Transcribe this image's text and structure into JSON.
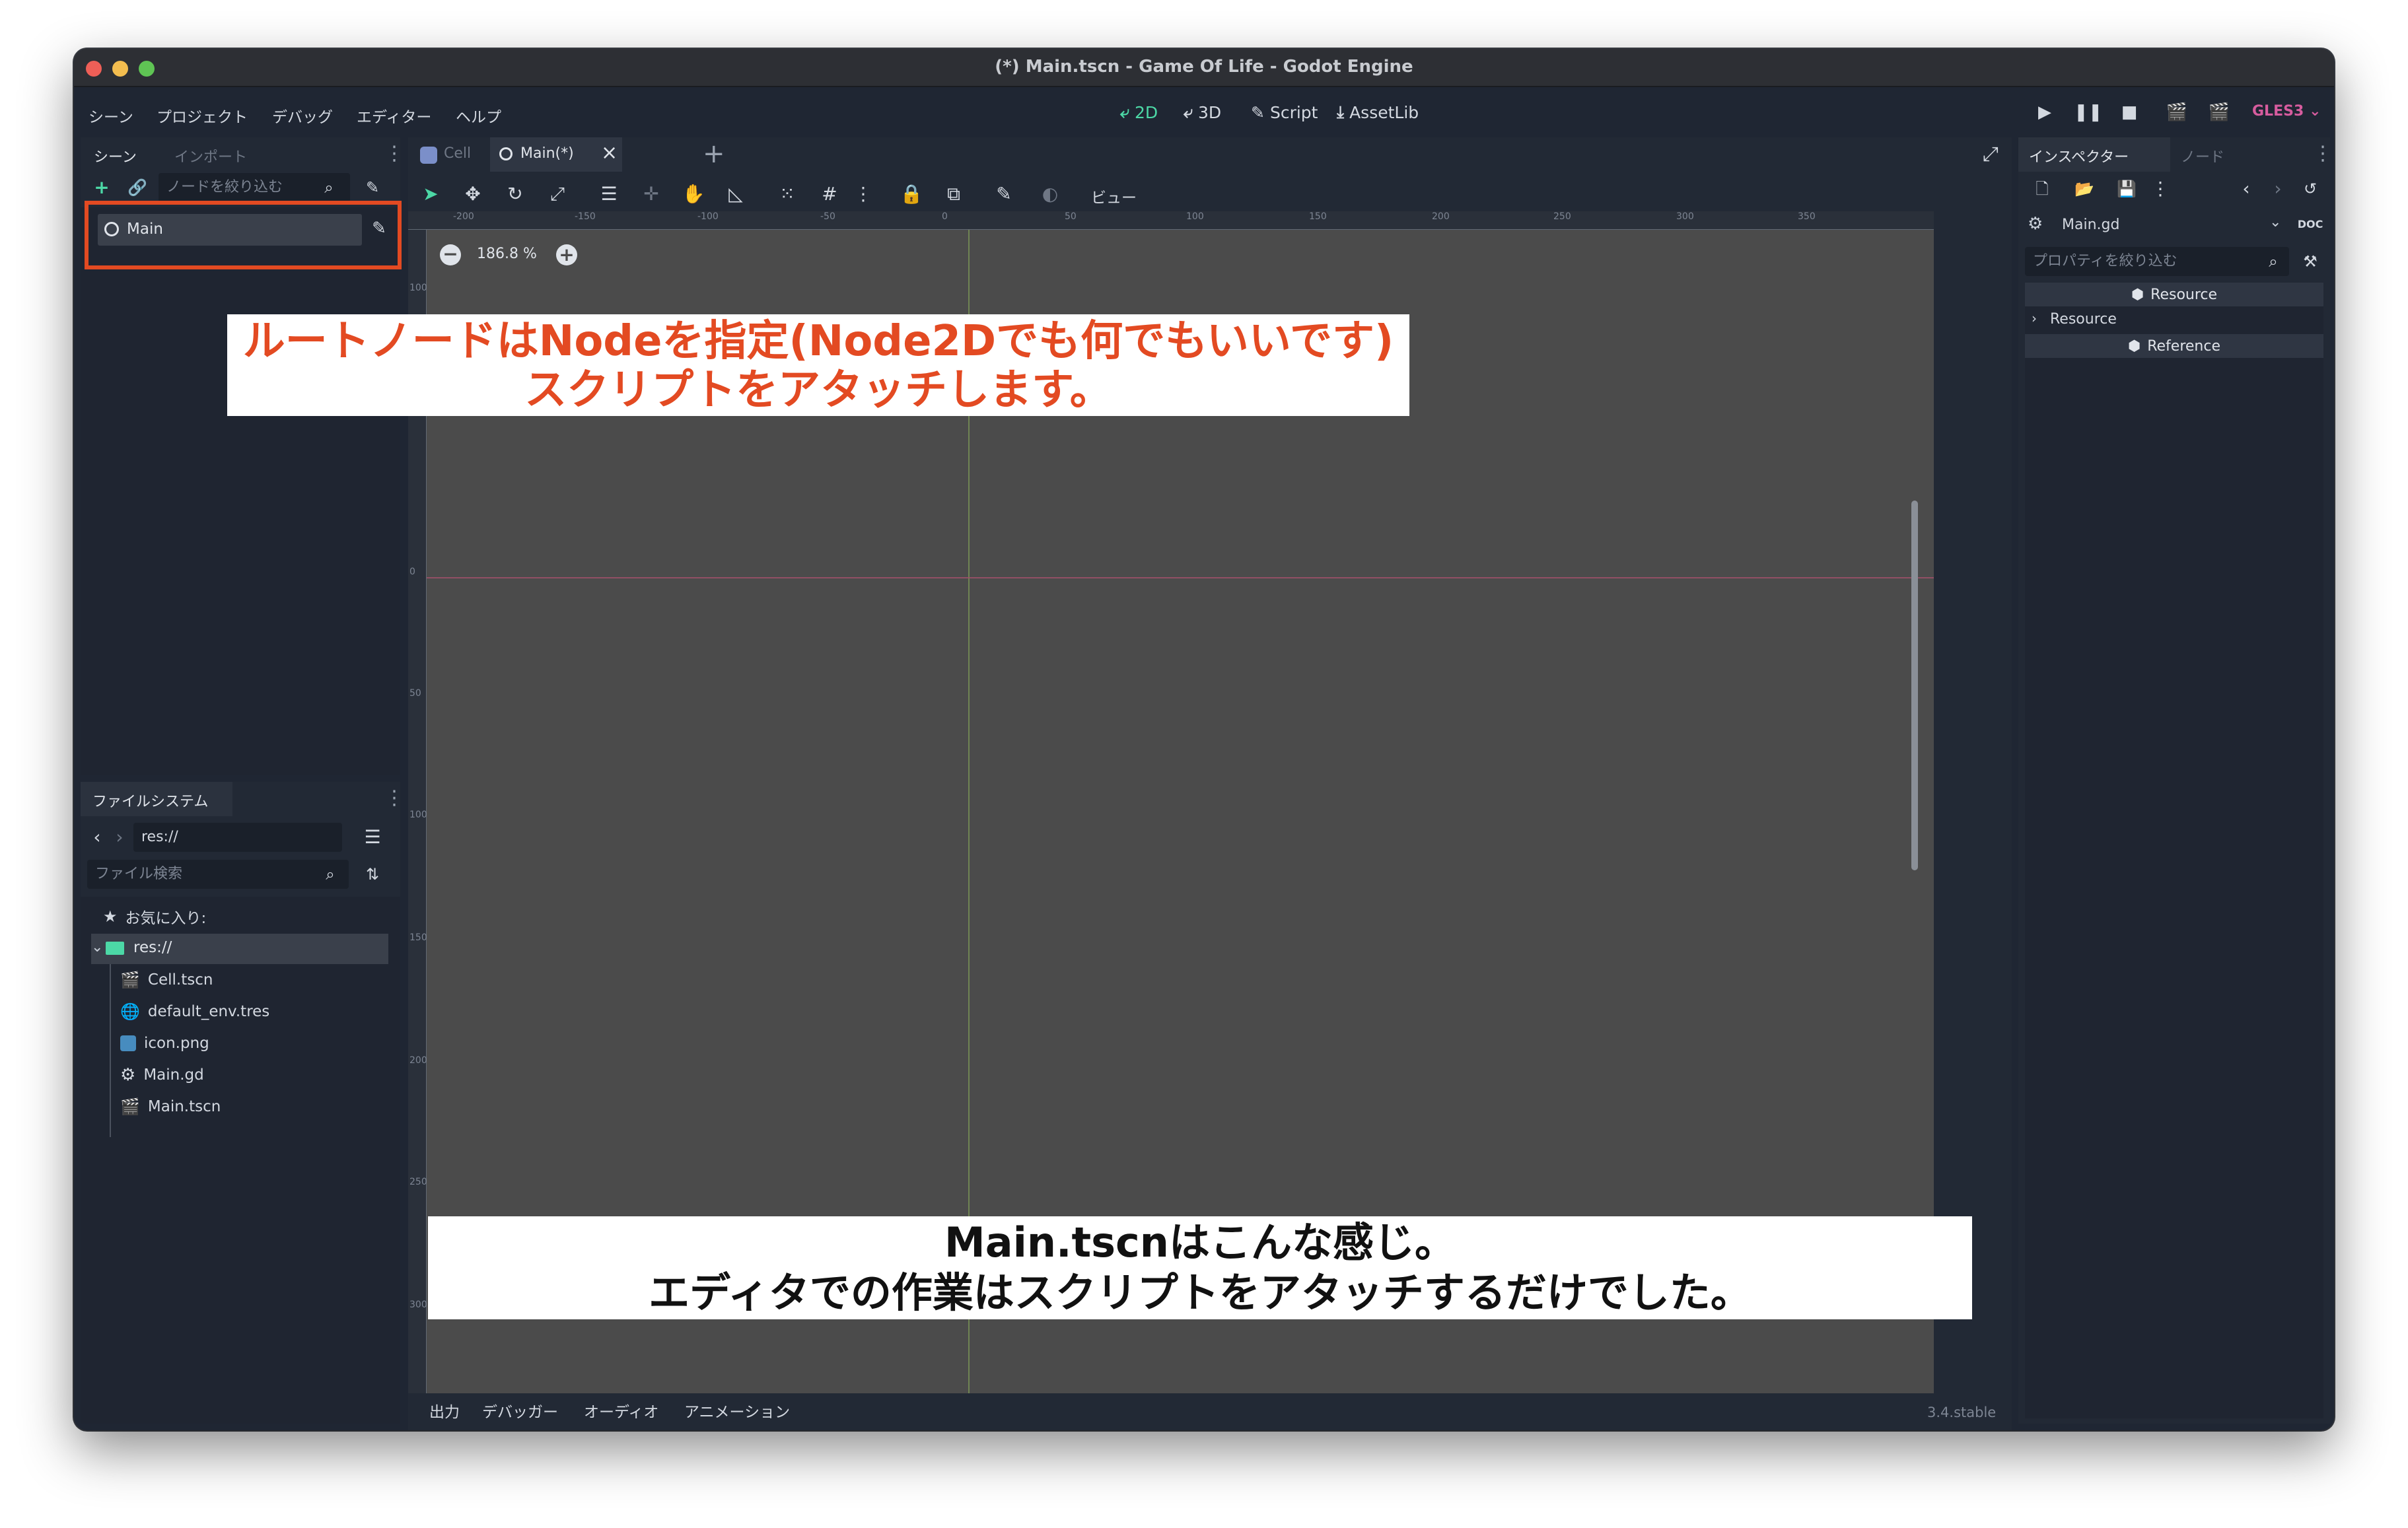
{
  "window": {
    "title": "(*) Main.tscn - Game Of Life - Godot Engine"
  },
  "menubar": {
    "items": [
      "シーン",
      "プロジェクト",
      "デバッグ",
      "エディター",
      "ヘルプ"
    ],
    "modes": [
      {
        "label": "2D",
        "icon": "2d-icon",
        "active": true
      },
      {
        "label": "3D",
        "icon": "3d-icon",
        "active": false
      },
      {
        "label": "Script",
        "icon": "script-icon",
        "active": false
      },
      {
        "label": "AssetLib",
        "icon": "assetlib-icon",
        "active": false
      }
    ],
    "renderer": "GLES3"
  },
  "scene_dock": {
    "tabs": [
      "シーン",
      "インポート"
    ],
    "filter_placeholder": "ノードを絞り込む",
    "root_node": "Main"
  },
  "filesystem_dock": {
    "title": "ファイルシステム",
    "path": "res://",
    "search_placeholder": "ファイル検索",
    "favorites_label": "お気に入り:",
    "root_folder": "res://",
    "files": [
      "Cell.tscn",
      "default_env.tres",
      "icon.png",
      "Main.gd",
      "Main.tscn"
    ]
  },
  "editor": {
    "tabs": [
      {
        "label": "Cell",
        "active": false
      },
      {
        "label": "Main(*)",
        "active": true
      }
    ],
    "view_menu": "ビュー",
    "zoom": "186.8 %",
    "ruler_h_ticks": [
      "-200",
      "-150",
      "-100",
      "-50",
      "0",
      "50",
      "100",
      "150",
      "200",
      "250",
      "300",
      "350"
    ],
    "ruler_v_ticks": [
      "100",
      "0",
      "50",
      "100",
      "150",
      "200",
      "250",
      "300"
    ]
  },
  "annotations": {
    "top_line1": "ルートノードはNodeを指定(Node2Dでも何でもいいです)",
    "top_line2": "スクリプトをアタッチします。",
    "bottom_line1": "Main.tscnはこんな感じ。",
    "bottom_line2": "エディタでの作業はスクリプトをアタッチするだけでした。"
  },
  "bottom_panel": {
    "tabs": [
      "出力",
      "デバッガー",
      "オーディオ",
      "アニメーション"
    ],
    "version": "3.4.stable"
  },
  "inspector": {
    "tabs": [
      "インスペクター",
      "ノード"
    ],
    "resource_name": "Main.gd",
    "filter_placeholder": "プロパティを絞り込む",
    "sections": [
      "Resource",
      "Resource",
      "Reference"
    ]
  },
  "colors": {
    "accent": "#4cd8a6",
    "highlight_box": "#e34a22",
    "annotation_red": "#e34a22",
    "renderer_label": "#d65c9e"
  }
}
